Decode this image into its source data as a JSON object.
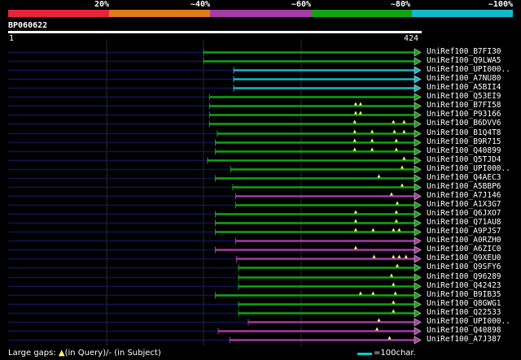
{
  "scale": {
    "labels": [
      "20%",
      "~40%",
      "~60%",
      "~80%",
      "~100%"
    ],
    "colors": [
      "#e8243c",
      "#e07b1a",
      "#a63aa6",
      "#13a313",
      "#14b8c8"
    ]
  },
  "query": {
    "name": "BP060622",
    "start": "1",
    "end": "424",
    "length": 424
  },
  "colors": {
    "green": "#13a313",
    "magenta": "#a63aa6",
    "cyan": "#14b8c8",
    "navy": "#12145a",
    "gap": "#ffff66"
  },
  "hits": [
    {
      "label": "UniRef100_B7FI30",
      "color": "green",
      "start": 203,
      "gaps": []
    },
    {
      "label": "UniRef100_Q9LWA5",
      "color": "green",
      "start": 203,
      "gaps": []
    },
    {
      "label": "UniRef100_UPI000..",
      "color": "cyan",
      "start": 234,
      "gaps": []
    },
    {
      "label": "UniRef100_A7NU80",
      "color": "cyan",
      "start": 234,
      "gaps": []
    },
    {
      "label": "UniRef100_A5BII4",
      "color": "cyan",
      "start": 234,
      "gaps": []
    },
    {
      "label": "UniRef100_Q53EI9",
      "color": "green",
      "start": 209,
      "gaps": []
    },
    {
      "label": "UniRef100_B7FI58",
      "color": "green",
      "start": 209,
      "gaps": [
        360,
        365
      ]
    },
    {
      "label": "UniRef100_P93166",
      "color": "green",
      "start": 209,
      "gaps": [
        360,
        365
      ]
    },
    {
      "label": "UniRef100_B6DVV6",
      "color": "green",
      "start": 209,
      "gaps": [
        359,
        399,
        410
      ]
    },
    {
      "label": "UniRef100_B1Q4T8",
      "color": "green",
      "start": 217,
      "gaps": [
        359,
        377,
        400,
        410
      ]
    },
    {
      "label": "UniRef100_B9R715",
      "color": "green",
      "start": 215,
      "gaps": [
        359,
        377,
        402
      ]
    },
    {
      "label": "UniRef100_Q40899",
      "color": "green",
      "start": 215,
      "gaps": [
        359,
        377,
        402
      ]
    },
    {
      "label": "UniRef100_Q5TJD4",
      "color": "green",
      "start": 207,
      "gaps": [
        410
      ]
    },
    {
      "label": "UniRef100_UPI000..",
      "color": "green",
      "start": 231,
      "gaps": [
        408
      ]
    },
    {
      "label": "UniRef100_Q4AEC3",
      "color": "green",
      "start": 215,
      "gaps": [
        384
      ]
    },
    {
      "label": "UniRef100_A5BBP6",
      "color": "green",
      "start": 233,
      "gaps": [
        408
      ]
    },
    {
      "label": "UniRef100_A7J146",
      "color": "magenta",
      "start": 236,
      "gaps": [
        397
      ]
    },
    {
      "label": "UniRef100_A1X3G7",
      "color": "green",
      "start": 236,
      "gaps": [
        403
      ]
    },
    {
      "label": "UniRef100_Q6JXO7",
      "color": "green",
      "start": 215,
      "gaps": [
        360,
        402
      ]
    },
    {
      "label": "UniRef100_Q71AU8",
      "color": "green",
      "start": 215,
      "gaps": [
        360,
        402
      ]
    },
    {
      "label": "UniRef100_A9PJS7",
      "color": "green",
      "start": 215,
      "gaps": [
        360,
        378,
        399,
        405
      ]
    },
    {
      "label": "UniRef100_A0RZH0",
      "color": "magenta",
      "start": 236,
      "gaps": []
    },
    {
      "label": "UniRef100_A6ZIC0",
      "color": "magenta",
      "start": 215,
      "gaps": [
        360
      ]
    },
    {
      "label": "UniRef100_Q9XEU0",
      "color": "magenta",
      "start": 237,
      "gaps": [
        379,
        399,
        405,
        412
      ]
    },
    {
      "label": "UniRef100_Q9SFY6",
      "color": "green",
      "start": 239,
      "gaps": [
        403
      ]
    },
    {
      "label": "UniRef100_Q96289",
      "color": "green",
      "start": 239,
      "gaps": [
        397
      ]
    },
    {
      "label": "UniRef100_Q42423",
      "color": "green",
      "start": 239,
      "gaps": [
        399
      ]
    },
    {
      "label": "UniRef100_B9IB35",
      "color": "green",
      "start": 215,
      "gaps": [
        365,
        378,
        401
      ]
    },
    {
      "label": "UniRef100_Q8GWG1",
      "color": "green",
      "start": 239,
      "gaps": [
        399
      ]
    },
    {
      "label": "UniRef100_Q22533",
      "color": "green",
      "start": 239,
      "gaps": [
        399
      ]
    },
    {
      "label": "UniRef100_UPI000..",
      "color": "magenta",
      "start": 249,
      "gaps": [
        384
      ]
    },
    {
      "label": "UniRef100_Q40898",
      "color": "magenta",
      "start": 218,
      "gaps": [
        382
      ]
    },
    {
      "label": "UniRef100_A7J387",
      "color": "magenta",
      "start": 230,
      "gaps": [
        395
      ]
    }
  ],
  "footer": {
    "legend_prefix": "Large gaps: ",
    "query_marker": "▲",
    "legend_query": "(in Query)/",
    "legend_subject_marker": "-",
    "legend_subject": " (in Subject)",
    "scale_text": "=100char."
  }
}
